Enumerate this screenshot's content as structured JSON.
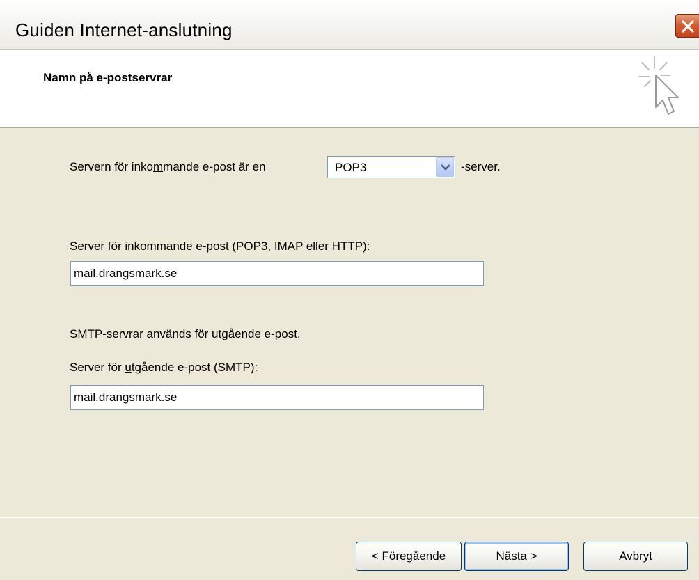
{
  "window": {
    "title": "Guiden Internet-anslutning"
  },
  "header": {
    "title": "Namn på e-postservrar",
    "icon": "wizard-cursor-icon"
  },
  "form": {
    "server_type_label_pre": "Servern för inko",
    "server_type_label_accel": "m",
    "server_type_label_post": "mande e-post är en",
    "server_type_value": "POP3",
    "server_type_suffix": "-server.",
    "incoming_label_pre": "Server för ",
    "incoming_label_accel": "i",
    "incoming_label_post": "nkommande e-post (POP3, IMAP eller HTTP):",
    "incoming_value": "mail.drangsmark.se",
    "smtp_info": "SMTP-servrar används för utgående e-post.",
    "outgoing_label_pre": "Server för ",
    "outgoing_label_accel": "u",
    "outgoing_label_post": "tgående e-post (SMTP):",
    "outgoing_value": "mail.drangsmark.se"
  },
  "buttons": {
    "back_pre": "< ",
    "back_accel": "F",
    "back_post": "öregående",
    "next_accel": "N",
    "next_post": "ästa >",
    "cancel": "Avbryt"
  },
  "colors": {
    "close_button": "#d45f34",
    "dialog_background": "#ece9d8",
    "button_border": "#003c74"
  }
}
